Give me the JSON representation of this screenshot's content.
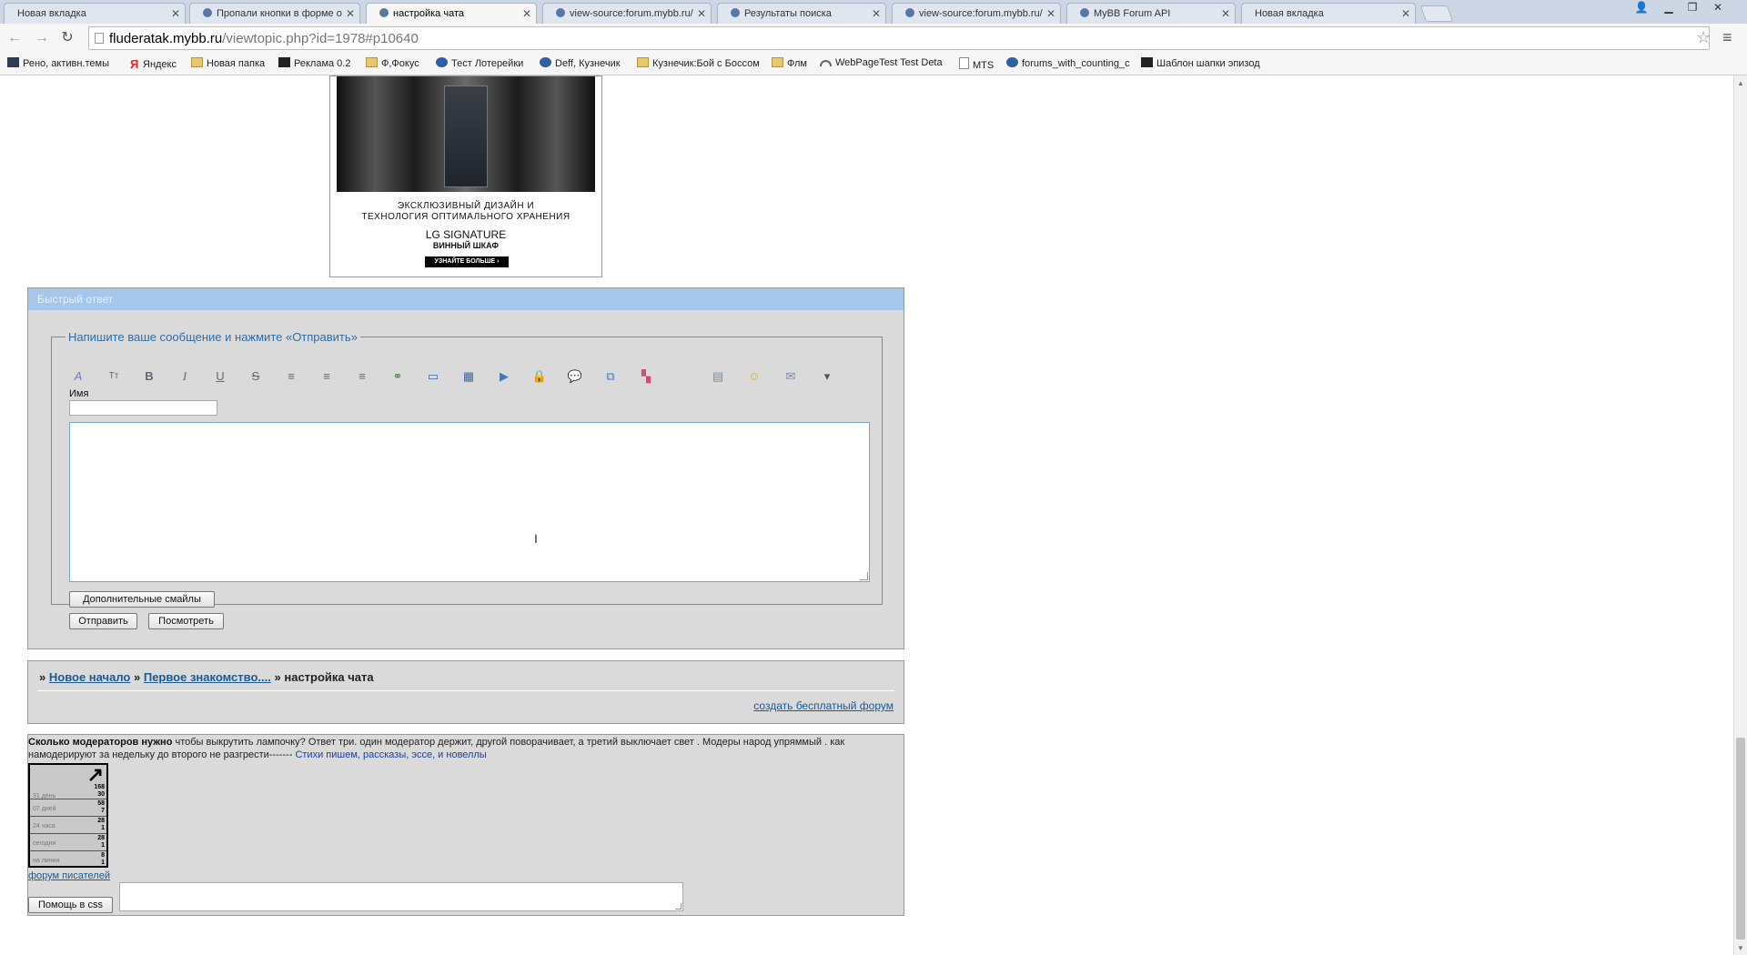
{
  "browser": {
    "tabs": [
      {
        "label": "Новая вкладка"
      },
      {
        "label": "Пропали кнопки в форме о"
      },
      {
        "label": "настройка чата"
      },
      {
        "label": "view-source:forum.mybb.ru/"
      },
      {
        "label": "Результаты поиска"
      },
      {
        "label": "view-source:forum.mybb.ru/"
      },
      {
        "label": "MyBB Forum API"
      },
      {
        "label": "Новая вкладка"
      }
    ],
    "url_host": "fluderatak.mybb.ru",
    "url_path": "/viewtopic.php?id=1978#p10640",
    "bookmarks": [
      {
        "label": "Рено, активн.темы",
        "icon": "photoshop-icon"
      },
      {
        "label": "Яндекс",
        "icon": "yandex-icon"
      },
      {
        "label": "Новая папка",
        "icon": "folder-icon"
      },
      {
        "label": "Реклама 0.2",
        "icon": "black-square-icon"
      },
      {
        "label": "Ф,Фокус",
        "icon": "folder-icon"
      },
      {
        "label": "Тест Лотерейки",
        "icon": "mybb-icon"
      },
      {
        "label": "Deff, Кузнечик",
        "icon": "mybb-icon"
      },
      {
        "label": "Кузнечик:Бой с Боссом",
        "icon": "folder-icon"
      },
      {
        "label": "Флм",
        "icon": "folder-icon"
      },
      {
        "label": "WebPageTest Test Deta",
        "icon": "gauge-icon"
      },
      {
        "label": "MTS",
        "icon": "page-icon"
      },
      {
        "label": "forums_with_counting_c",
        "icon": "mybb-icon"
      },
      {
        "label": "Шаблон шапки эпизод",
        "icon": "black-square-icon"
      }
    ]
  },
  "ad": {
    "slogan_line1": "ЭКСКЛЮЗИВНЫЙ ДИЗАЙН И",
    "slogan_line2": "ТЕХНОЛОГИЯ ОПТИМАЛЬНОГО ХРАНЕНИЯ",
    "brand": "LG SIGNATURE",
    "product": "ВИННЫЙ ШКАФ",
    "cta": "УЗНАЙТЕ БОЛЬШЕ  ›"
  },
  "quick_reply": {
    "header": "Быстрый ответ",
    "legend": "Напишите ваше сообщение и нажмите «Отправить»",
    "name_label": "Имя",
    "more_smiles": "Дополнительные смайлы",
    "submit": "Отправить",
    "preview": "Посмотреть"
  },
  "breadcrumbs": {
    "prefix": "»",
    "items": [
      "Новое начало",
      "Первое знакомство....",
      "настройка чата"
    ],
    "create_forum": "создать бесплатный форум"
  },
  "footer": {
    "joke_bold": "Сколько модераторов нужно",
    "joke_text": " чтобы выкрутить лампочку? Ответ три. один модератор держит, другой поворачивает, а третий выключает свет . Модеры народ упряммый . как намодерируют за недельку до второго не разгрести------- ",
    "joke_link": "Стихи пишем, рассказы, эссе, и новеллы",
    "counter_rows": [
      {
        "label": "31 день",
        "v1": "168",
        "v2": "30"
      },
      {
        "label": "07 дней",
        "v1": "58",
        "v2": "7"
      },
      {
        "label": "24 часа",
        "v1": "28",
        "v2": "1"
      },
      {
        "label": "сегодня",
        "v1": "28",
        "v2": "1"
      },
      {
        "label": "на линии",
        "v1": "8",
        "v2": "1"
      }
    ],
    "forum_link": "форум писателей",
    "css_help_button": "Помощь в css"
  }
}
